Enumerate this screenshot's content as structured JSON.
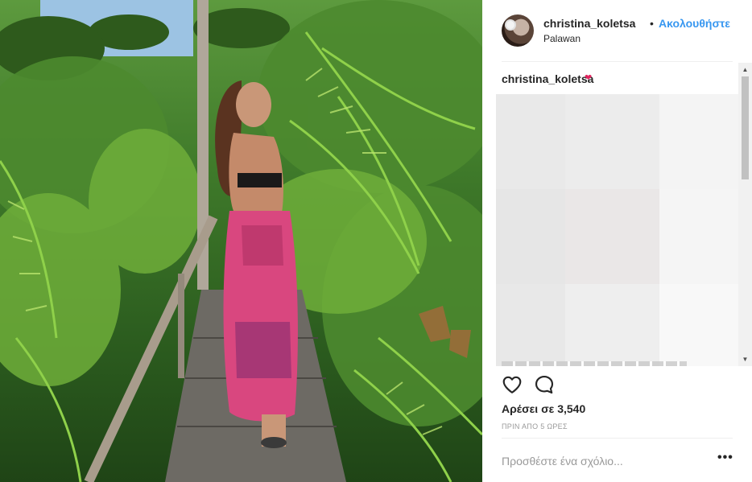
{
  "post": {
    "username": "christina_koletsa",
    "separator": "•",
    "follow_label": "Ακολουθήστε",
    "location": "Palawan",
    "caption_username": "christina_koletsa",
    "caption_emoji": "❤",
    "likes_text": "Αρέσει σε 3,540",
    "time_text": "ΠΡΙΝ ΑΠΟ 5 ΩΡΕΣ",
    "comment_placeholder": "Προσθέστε ένα σχόλιο...",
    "more_label": "•••"
  },
  "icons": {
    "like": "heart-icon",
    "comment": "comment-icon",
    "scroll_up": "scroll-up-arrow-icon",
    "scroll_down": "scroll-down-arrow-icon"
  },
  "scrollbar": {
    "up_glyph": "▲",
    "down_glyph": "▼"
  },
  "colors": {
    "follow": "#3897f0",
    "text": "#262626",
    "muted": "#999999",
    "divider": "#efefef"
  },
  "pixelated_region": {
    "cells": [
      "#e9e9e9",
      "#ececec",
      "#f4f4f4",
      "#e6e6e6",
      "#eae7e7",
      "#f5f5f5",
      "#e8e8e8",
      "#eeeeee",
      "#f8f8f8"
    ]
  }
}
